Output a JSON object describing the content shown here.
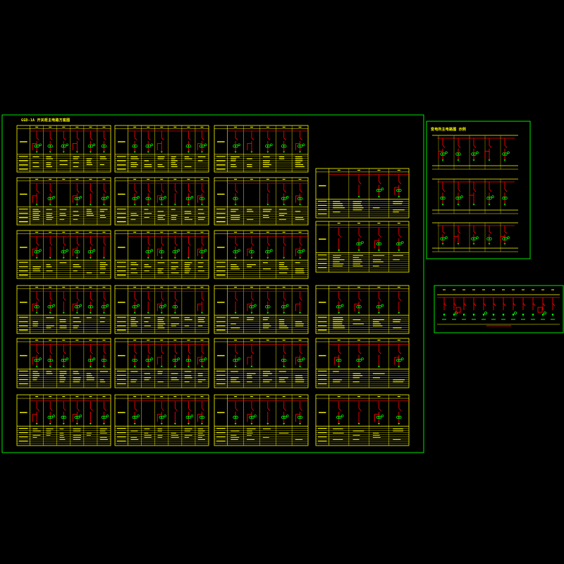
{
  "drawing": {
    "main_title": "GGD-1A 开关柜主电路方案图",
    "side_title": "变电所主电路图 示例",
    "sheet_rows": 6,
    "panel_columns": [
      6,
      6,
      5,
      4
    ],
    "colors": {
      "background": "#000000",
      "frame": "#00ff00",
      "table": "#ffff00",
      "busbar": "#ff0000",
      "device": "#00ff00",
      "text": "#ffff00"
    }
  }
}
